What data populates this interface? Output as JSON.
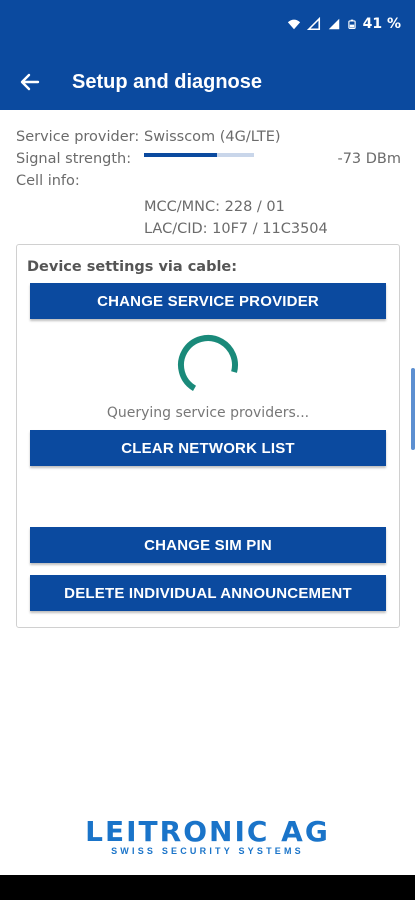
{
  "status_bar": {
    "battery": "41 %",
    "icons": [
      "wifi-icon",
      "signal-icon",
      "signal-icon",
      "battery-icon"
    ]
  },
  "app_bar": {
    "title": "Setup and diagnose",
    "back_icon": "arrow-left-icon"
  },
  "info": {
    "service_provider_label": "Service provider:",
    "service_provider_value": "Swisscom (4G/LTE)",
    "signal_strength_label": "Signal strength:",
    "signal_strength_value": "-73 DBm",
    "signal_level_fraction": 0.66,
    "cell_info_label": "Cell info:",
    "mcc_mnc": "MCC/MNC: 228 / 01",
    "lac_cid": "LAC/CID: 10F7 / 11C3504"
  },
  "card": {
    "title": "Device settings via cable:",
    "buttons": {
      "change_service_provider": "CHANGE SERVICE PROVIDER",
      "clear_network_list": "CLEAR NETWORK LIST",
      "change_sim_pin": "CHANGE SIM PIN",
      "delete_individual_announcement": "DELETE INDIVIDUAL ANNOUNCEMENT"
    },
    "querying_text": "Querying service providers..."
  },
  "logo": {
    "name": "LEITRONIC AG",
    "tagline": "SWISS SECURITY SYSTEMS"
  },
  "colors": {
    "primary": "#0b4a9f",
    "spinner": "#1a8a7a",
    "logo": "#1a74c9"
  }
}
